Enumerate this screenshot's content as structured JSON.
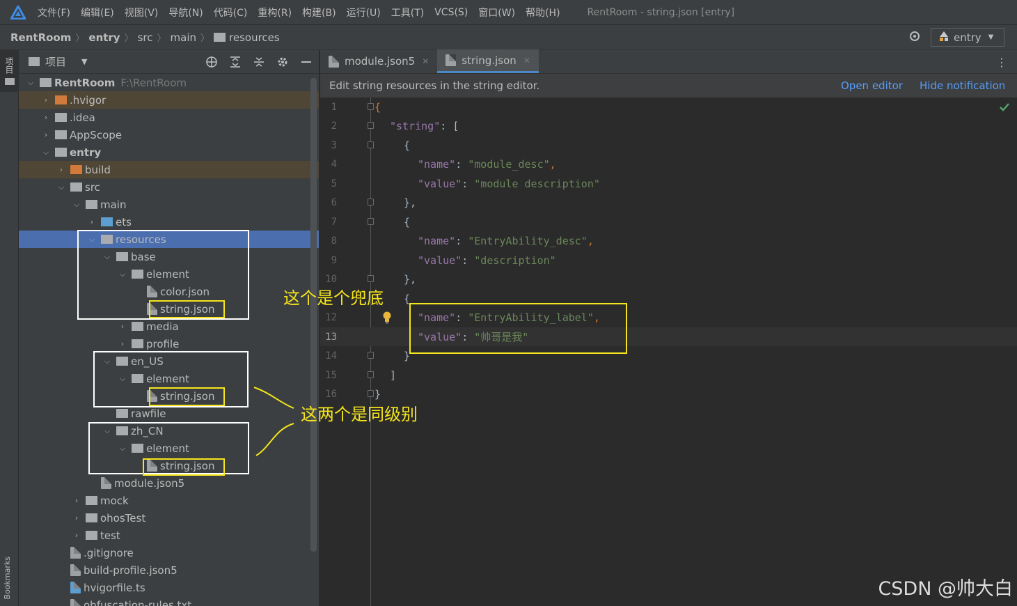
{
  "menubar": {
    "items": [
      "文件(F)",
      "编辑(E)",
      "视图(V)",
      "导航(N)",
      "代码(C)",
      "重构(R)",
      "构建(B)",
      "运行(U)",
      "工具(T)",
      "VCS(S)",
      "窗口(W)",
      "帮助(H)"
    ],
    "window_title": "RentRoom - string.json [entry]"
  },
  "navbar": {
    "breadcrumbs": [
      "RentRoom",
      "entry",
      "src",
      "main",
      "resources"
    ],
    "run_config": "entry"
  },
  "left_strip": {
    "project_tab": "项目",
    "bookmarks_tab": "Bookmarks"
  },
  "project_panel": {
    "title": "项目",
    "tree": [
      {
        "label": "RentRoom",
        "path": "F:\\RentRoom",
        "icon": "module-folder"
      },
      {
        "label": ".hvigor",
        "icon": "folder-orange"
      },
      {
        "label": ".idea",
        "icon": "folder"
      },
      {
        "label": "AppScope",
        "icon": "folder"
      },
      {
        "label": "entry",
        "icon": "module-folder"
      },
      {
        "label": "build",
        "icon": "folder-orange"
      },
      {
        "label": "src",
        "icon": "folder"
      },
      {
        "label": "main",
        "icon": "folder"
      },
      {
        "label": "ets",
        "icon": "folder-blue"
      },
      {
        "label": "resources",
        "icon": "folder"
      },
      {
        "label": "base",
        "icon": "folder"
      },
      {
        "label": "element",
        "icon": "folder"
      },
      {
        "label": "color.json",
        "icon": "json-file"
      },
      {
        "label": "string.json",
        "icon": "json-file"
      },
      {
        "label": "media",
        "icon": "folder"
      },
      {
        "label": "profile",
        "icon": "folder"
      },
      {
        "label": "en_US",
        "icon": "folder"
      },
      {
        "label": "element",
        "icon": "folder"
      },
      {
        "label": "string.json",
        "icon": "json-file"
      },
      {
        "label": "rawfile",
        "icon": "folder"
      },
      {
        "label": "zh_CN",
        "icon": "folder"
      },
      {
        "label": "element",
        "icon": "folder"
      },
      {
        "label": "string.json",
        "icon": "json-file"
      },
      {
        "label": "module.json5",
        "icon": "json-file"
      },
      {
        "label": "mock",
        "icon": "folder"
      },
      {
        "label": "ohosTest",
        "icon": "folder"
      },
      {
        "label": "test",
        "icon": "folder"
      },
      {
        "label": ".gitignore",
        "icon": "text-file"
      },
      {
        "label": "build-profile.json5",
        "icon": "json-file"
      },
      {
        "label": "hvigorfile.ts",
        "icon": "ts-file"
      },
      {
        "label": "obfuscation-rules.txt",
        "icon": "text-file"
      }
    ]
  },
  "editor": {
    "tabs": [
      {
        "label": "module.json5",
        "active": false
      },
      {
        "label": "string.json",
        "active": true
      }
    ],
    "notification": {
      "message": "Edit string resources in the string editor.",
      "open_editor": "Open editor",
      "hide": "Hide notification"
    },
    "line_numbers": [
      "1",
      "2",
      "3",
      "4",
      "5",
      "6",
      "7",
      "8",
      "9",
      "10",
      "12",
      "13",
      "14",
      "15",
      "16"
    ],
    "current_line": "13",
    "code": [
      {
        "k": "",
        "v": "{",
        "sep": ""
      },
      {
        "k": "\"string\"",
        "v": "[",
        "sep": ": "
      },
      {
        "k": "",
        "v": "{",
        "sep": ""
      },
      {
        "k": "\"name\"",
        "v": "\"module_desc\"",
        "sep": ": "
      },
      {
        "k": "\"value\"",
        "v": "\"module description\"",
        "sep": ": "
      },
      {
        "k": "",
        "v": "},",
        "sep": ""
      },
      {
        "k": "",
        "v": "{",
        "sep": ""
      },
      {
        "k": "\"name\"",
        "v": "\"EntryAbility_desc\"",
        "sep": ": "
      },
      {
        "k": "\"value\"",
        "v": "\"description\"",
        "sep": ": "
      },
      {
        "k": "",
        "v": "},",
        "sep": ""
      },
      {
        "k": "",
        "v": "{",
        "sep": ""
      },
      {
        "k": "\"name\"",
        "v": "\"EntryAbility_label\"",
        "sep": ": "
      },
      {
        "k": "\"value\"",
        "v": "\"帅哥是我\"",
        "sep": ": "
      },
      {
        "k": "",
        "v": "}",
        "sep": ""
      },
      {
        "k": "",
        "v": "]",
        "sep": ""
      },
      {
        "k": "",
        "v": "}",
        "sep": ""
      }
    ]
  },
  "annotations": {
    "note1": "这个是个兜底",
    "note2": "这两个是同级别"
  },
  "watermark": "CSDN @帅大白",
  "colors": {
    "selection": "#4b6eaf",
    "annotation": "#f5e51c",
    "link": "#589df6"
  }
}
